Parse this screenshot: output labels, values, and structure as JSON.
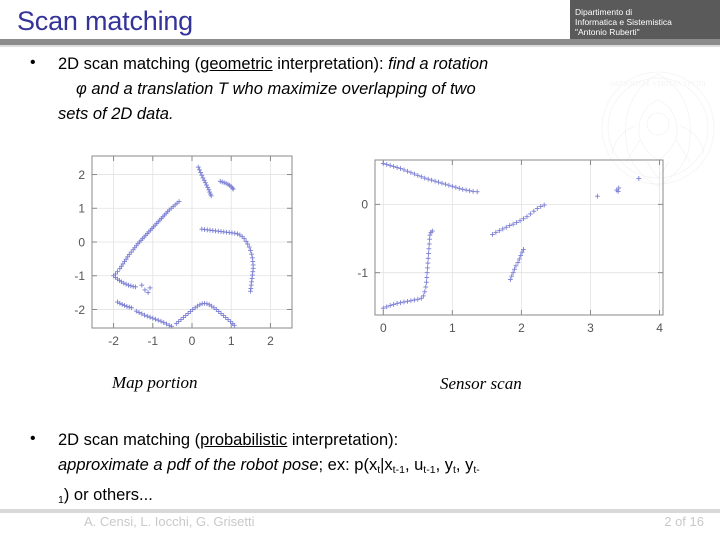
{
  "slide": {
    "title": "Scan matching",
    "accent_color": "#33339a",
    "header_bar_color": "#8c8c8c"
  },
  "logo": {
    "line1": "Dipartimento di",
    "line2": "Informatica e Sistemistica",
    "line3": "\"Antonio Ruberti\"",
    "background": "#5a5a5a",
    "swatch_color": "#43b7e8"
  },
  "watermark": {
    "name": "university-seal-watermark"
  },
  "bullets": [
    {
      "marker": "•",
      "line1_plain_a": "2D scan matching (",
      "line1_underlined": "geometric",
      "line1_plain_b": " interpretation): ",
      "line1_italic": "find a rotation",
      "line2_italic": "φ and a translation T who maximize overlapping of two",
      "line3_italic": "sets of 2D data."
    },
    {
      "marker": "•",
      "line1_plain_a": "2D scan matching (",
      "line1_underlined": "probabilistic",
      "line1_plain_b": " interpretation):",
      "line2_italic": "approximate a pdf of the robot pose",
      "line2_plain": "; ex: p(x",
      "formula_sub_1": "t",
      "formula_mid_1": "|x",
      "formula_sub_2": "t-1",
      "formula_mid_2": ", u",
      "formula_sub_3": "t-1",
      "formula_mid_3": ", y",
      "formula_sub_4": "t",
      "formula_mid_4": ", y",
      "formula_sub_5": "t-",
      "line3_sub": "1",
      "line3_plain": ") or others..."
    }
  ],
  "captions": {
    "left": "Map portion",
    "right": "Sensor scan"
  },
  "footer": {
    "authors": "A. Censi, L. Iocchi, G. Grisetti",
    "page": "2 of  16",
    "text_color": "#c9c9c9"
  },
  "chart_data": [
    {
      "type": "scatter",
      "title": "Map portion",
      "marker": "+",
      "marker_color": "#7b7fd4",
      "xlabel": "",
      "ylabel": "",
      "xlim": [
        -2.55,
        2.55
      ],
      "ylim": [
        -2.55,
        2.55
      ],
      "xticks": [
        -2,
        -1,
        0,
        1,
        2
      ],
      "yticks": [
        -2,
        -1,
        0,
        1,
        2
      ],
      "grid": true,
      "points": [
        [
          0.16,
          2.22
        ],
        [
          0.19,
          2.14
        ],
        [
          0.22,
          2.06
        ],
        [
          0.25,
          1.98
        ],
        [
          0.28,
          1.9
        ],
        [
          0.31,
          1.83
        ],
        [
          0.34,
          1.76
        ],
        [
          0.37,
          1.69
        ],
        [
          0.4,
          1.62
        ],
        [
          0.43,
          1.55
        ],
        [
          0.45,
          1.48
        ],
        [
          0.47,
          1.42
        ],
        [
          0.49,
          1.37
        ],
        [
          0.72,
          1.8
        ],
        [
          0.77,
          1.78
        ],
        [
          0.82,
          1.76
        ],
        [
          0.87,
          1.74
        ],
        [
          0.92,
          1.71
        ],
        [
          0.96,
          1.68
        ],
        [
          1.0,
          1.64
        ],
        [
          1.03,
          1.6
        ],
        [
          1.05,
          1.57
        ],
        [
          -0.33,
          1.2
        ],
        [
          -0.38,
          1.15
        ],
        [
          -0.43,
          1.1
        ],
        [
          -0.48,
          1.05
        ],
        [
          -0.53,
          1.0
        ],
        [
          -0.58,
          0.95
        ],
        [
          -0.62,
          0.9
        ],
        [
          -0.66,
          0.85
        ],
        [
          -0.7,
          0.8
        ],
        [
          -0.74,
          0.75
        ],
        [
          -0.78,
          0.7
        ],
        [
          -0.82,
          0.65
        ],
        [
          -0.86,
          0.6
        ],
        [
          -0.9,
          0.55
        ],
        [
          -0.94,
          0.5
        ],
        [
          -0.98,
          0.45
        ],
        [
          -1.02,
          0.4
        ],
        [
          -1.06,
          0.35
        ],
        [
          -1.1,
          0.3
        ],
        [
          -1.14,
          0.25
        ],
        [
          -1.18,
          0.2
        ],
        [
          -1.22,
          0.15
        ],
        [
          -1.26,
          0.1
        ],
        [
          -1.3,
          0.05
        ],
        [
          -1.34,
          0.0
        ],
        [
          -1.38,
          -0.05
        ],
        [
          -1.42,
          -0.11
        ],
        [
          -1.46,
          -0.17
        ],
        [
          -1.5,
          -0.23
        ],
        [
          -1.55,
          -0.3
        ],
        [
          -1.6,
          -0.37
        ],
        [
          -1.64,
          -0.44
        ],
        [
          -1.68,
          -0.51
        ],
        [
          -1.72,
          -0.58
        ],
        [
          -1.76,
          -0.65
        ],
        [
          -1.8,
          -0.72
        ],
        [
          -1.84,
          -0.79
        ],
        [
          -1.9,
          -0.88
        ],
        [
          -1.95,
          -0.95
        ],
        [
          -2.0,
          -1.0
        ],
        [
          0.25,
          0.38
        ],
        [
          0.32,
          0.37
        ],
        [
          0.39,
          0.36
        ],
        [
          0.46,
          0.35
        ],
        [
          0.53,
          0.34
        ],
        [
          0.6,
          0.33
        ],
        [
          0.67,
          0.32
        ],
        [
          0.74,
          0.31
        ],
        [
          0.81,
          0.3
        ],
        [
          0.88,
          0.29
        ],
        [
          0.95,
          0.28
        ],
        [
          1.02,
          0.27
        ],
        [
          1.09,
          0.26
        ],
        [
          1.16,
          0.24
        ],
        [
          1.22,
          0.21
        ],
        [
          1.28,
          0.16
        ],
        [
          1.33,
          0.1
        ],
        [
          1.38,
          0.02
        ],
        [
          1.42,
          -0.06
        ],
        [
          1.46,
          -0.15
        ],
        [
          1.49,
          -0.25
        ],
        [
          1.52,
          -0.36
        ],
        [
          1.54,
          -0.47
        ],
        [
          1.55,
          -0.58
        ],
        [
          1.56,
          -0.68
        ],
        [
          1.56,
          -0.78
        ],
        [
          1.55,
          -0.88
        ],
        [
          1.54,
          -0.98
        ],
        [
          1.53,
          -1.08
        ],
        [
          1.52,
          -1.18
        ],
        [
          1.51,
          -1.28
        ],
        [
          1.5,
          -1.38
        ],
        [
          1.49,
          -1.46
        ],
        [
          -1.95,
          -1.05
        ],
        [
          -1.9,
          -1.1
        ],
        [
          -1.85,
          -1.14
        ],
        [
          -1.8,
          -1.18
        ],
        [
          -1.74,
          -1.22
        ],
        [
          -1.68,
          -1.25
        ],
        [
          -1.62,
          -1.28
        ],
        [
          -1.56,
          -1.3
        ],
        [
          -1.5,
          -1.32
        ],
        [
          -1.44,
          -1.33
        ],
        [
          -1.28,
          -1.28
        ],
        [
          -1.2,
          -1.42
        ],
        [
          -1.07,
          -1.36
        ],
        [
          -1.12,
          -1.5
        ],
        [
          -1.9,
          -1.78
        ],
        [
          -1.84,
          -1.82
        ],
        [
          -1.78,
          -1.85
        ],
        [
          -1.72,
          -1.88
        ],
        [
          -1.66,
          -1.91
        ],
        [
          -1.6,
          -1.93
        ],
        [
          -1.54,
          -1.95
        ],
        [
          -1.42,
          -2.05
        ],
        [
          -1.35,
          -2.09
        ],
        [
          -1.28,
          -2.13
        ],
        [
          -1.21,
          -2.17
        ],
        [
          -1.14,
          -2.2
        ],
        [
          -1.07,
          -2.23
        ],
        [
          -1.0,
          -2.26
        ],
        [
          -0.93,
          -2.29
        ],
        [
          -0.86,
          -2.32
        ],
        [
          -0.79,
          -2.35
        ],
        [
          -0.72,
          -2.39
        ],
        [
          -0.65,
          -2.43
        ],
        [
          -0.58,
          -2.47
        ],
        [
          -0.52,
          -2.5
        ],
        [
          -0.4,
          -2.42
        ],
        [
          -0.34,
          -2.36
        ],
        [
          -0.28,
          -2.3
        ],
        [
          -0.22,
          -2.24
        ],
        [
          -0.16,
          -2.18
        ],
        [
          -0.1,
          -2.12
        ],
        [
          -0.04,
          -2.06
        ],
        [
          0.02,
          -2.0
        ],
        [
          0.08,
          -1.95
        ],
        [
          0.14,
          -1.9
        ],
        [
          0.2,
          -1.86
        ],
        [
          0.26,
          -1.83
        ],
        [
          0.32,
          -1.82
        ],
        [
          0.38,
          -1.83
        ],
        [
          0.44,
          -1.86
        ],
        [
          0.5,
          -1.9
        ],
        [
          0.56,
          -1.95
        ],
        [
          0.62,
          -2.0
        ],
        [
          0.68,
          -2.06
        ],
        [
          0.74,
          -2.12
        ],
        [
          0.8,
          -2.18
        ],
        [
          0.86,
          -2.24
        ],
        [
          0.92,
          -2.3
        ],
        [
          0.98,
          -2.36
        ],
        [
          1.04,
          -2.42
        ],
        [
          1.08,
          -2.47
        ]
      ]
    },
    {
      "type": "scatter",
      "title": "Sensor scan",
      "marker": "+",
      "marker_color": "#7b7fd4",
      "xlabel": "",
      "ylabel": "",
      "xlim": [
        -0.12,
        4.05
      ],
      "ylim": [
        -1.62,
        0.65
      ],
      "xticks": [
        0,
        1,
        2,
        3,
        4
      ],
      "yticks": [
        -1,
        0
      ],
      "grid": true,
      "points": [
        [
          0.0,
          0.6
        ],
        [
          0.05,
          0.585
        ],
        [
          0.1,
          0.57
        ],
        [
          0.15,
          0.555
        ],
        [
          0.2,
          0.54
        ],
        [
          0.25,
          0.525
        ],
        [
          0.3,
          0.505
        ],
        [
          0.35,
          0.485
        ],
        [
          0.4,
          0.465
        ],
        [
          0.45,
          0.445
        ],
        [
          0.5,
          0.425
        ],
        [
          0.55,
          0.405
        ],
        [
          0.6,
          0.385
        ],
        [
          0.65,
          0.37
        ],
        [
          0.7,
          0.355
        ],
        [
          0.75,
          0.34
        ],
        [
          0.8,
          0.325
        ],
        [
          0.85,
          0.31
        ],
        [
          0.9,
          0.295
        ],
        [
          0.95,
          0.28
        ],
        [
          1.0,
          0.265
        ],
        [
          1.05,
          0.25
        ],
        [
          1.1,
          0.235
        ],
        [
          1.15,
          0.22
        ],
        [
          1.2,
          0.21
        ],
        [
          1.25,
          0.2
        ],
        [
          1.3,
          0.19
        ],
        [
          1.36,
          0.185
        ],
        [
          0.0,
          -1.52
        ],
        [
          0.05,
          -1.5
        ],
        [
          0.1,
          -1.48
        ],
        [
          0.15,
          -1.465
        ],
        [
          0.2,
          -1.45
        ],
        [
          0.25,
          -1.44
        ],
        [
          0.3,
          -1.43
        ],
        [
          0.35,
          -1.42
        ],
        [
          0.4,
          -1.41
        ],
        [
          0.45,
          -1.4
        ],
        [
          0.5,
          -1.39
        ],
        [
          0.55,
          -1.375
        ],
        [
          0.58,
          -1.34
        ],
        [
          0.6,
          -1.28
        ],
        [
          0.615,
          -1.21
        ],
        [
          0.625,
          -1.14
        ],
        [
          0.63,
          -1.07
        ],
        [
          0.635,
          -1.0
        ],
        [
          0.64,
          -0.93
        ],
        [
          0.645,
          -0.86
        ],
        [
          0.65,
          -0.79
        ],
        [
          0.655,
          -0.72
        ],
        [
          0.66,
          -0.65
        ],
        [
          0.665,
          -0.58
        ],
        [
          0.67,
          -0.51
        ],
        [
          0.675,
          -0.45
        ],
        [
          0.69,
          -0.41
        ],
        [
          0.71,
          -0.39
        ],
        [
          1.58,
          -0.44
        ],
        [
          1.63,
          -0.41
        ],
        [
          1.68,
          -0.385
        ],
        [
          1.73,
          -0.36
        ],
        [
          1.78,
          -0.335
        ],
        [
          1.83,
          -0.31
        ],
        [
          1.88,
          -0.29
        ],
        [
          1.93,
          -0.265
        ],
        [
          1.98,
          -0.24
        ],
        [
          2.03,
          -0.21
        ],
        [
          2.08,
          -0.18
        ],
        [
          2.13,
          -0.14
        ],
        [
          2.18,
          -0.1
        ],
        [
          2.23,
          -0.06
        ],
        [
          2.28,
          -0.03
        ],
        [
          2.33,
          -0.01
        ],
        [
          1.84,
          -1.1
        ],
        [
          1.86,
          -1.05
        ],
        [
          1.88,
          -1.0
        ],
        [
          1.9,
          -0.95
        ],
        [
          1.92,
          -0.9
        ],
        [
          1.95,
          -0.85
        ],
        [
          1.97,
          -0.8
        ],
        [
          1.99,
          -0.75
        ],
        [
          2.01,
          -0.7
        ],
        [
          2.03,
          -0.66
        ],
        [
          3.1,
          0.12
        ],
        [
          3.38,
          0.21
        ],
        [
          3.4,
          0.19
        ],
        [
          3.41,
          0.24
        ],
        [
          3.7,
          0.38
        ]
      ]
    }
  ]
}
